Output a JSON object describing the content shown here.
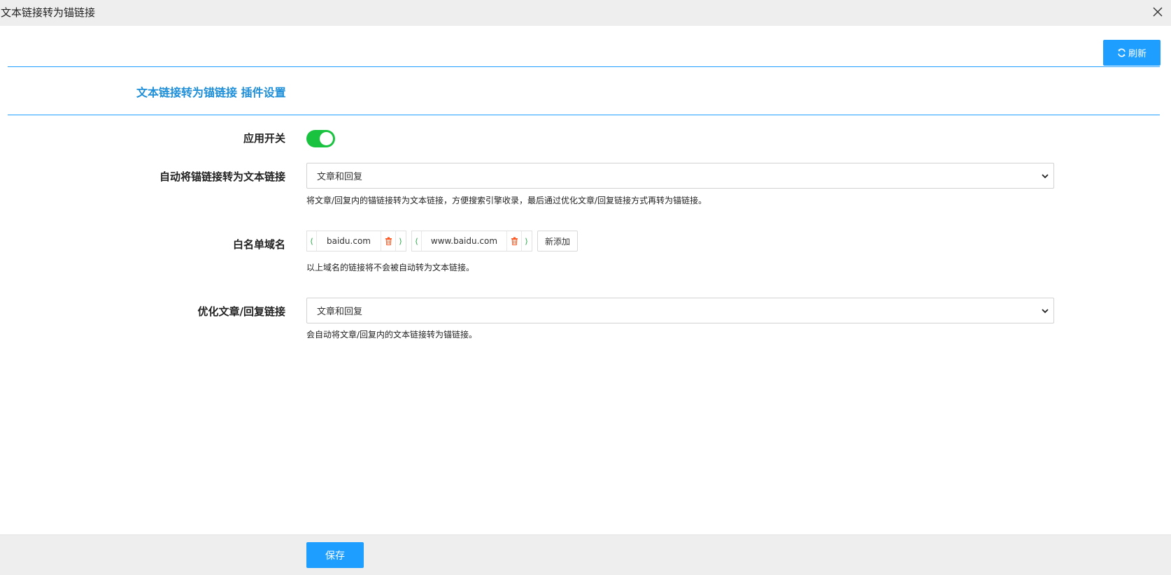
{
  "window": {
    "title": "文本链接转为锚链接",
    "close_icon": "close-icon"
  },
  "toolbar": {
    "refresh_label": "刷新",
    "refresh_icon": "refresh-icon"
  },
  "section": {
    "title": "文本链接转为锚链接 插件设置"
  },
  "form": {
    "app_switch": {
      "label": "应用开关",
      "enabled": true
    },
    "auto_convert": {
      "label": "自动将锚链接转为文本链接",
      "selected": "文章和回复",
      "help": "将文章/回复内的锚链接转为文本链接，方便搜索引擎收录，最后通过优化文章/回复链接方式再转为锚链接。"
    },
    "whitelist": {
      "label": "白名单域名",
      "items": [
        {
          "value": "baidu.com"
        },
        {
          "value": "www.baidu.com"
        }
      ],
      "add_label": "新添加",
      "help": "以上域名的链接将不会被自动转为文本链接。"
    },
    "optimize": {
      "label": "优化文章/回复链接",
      "selected": "文章和回复",
      "help": "会自动将文章/回复内的文本链接转为锚链接。"
    }
  },
  "footer": {
    "save_label": "保存"
  },
  "colors": {
    "accent": "#1e9fff",
    "toggle_on": "#19c33f",
    "delete": "#ff5722"
  }
}
